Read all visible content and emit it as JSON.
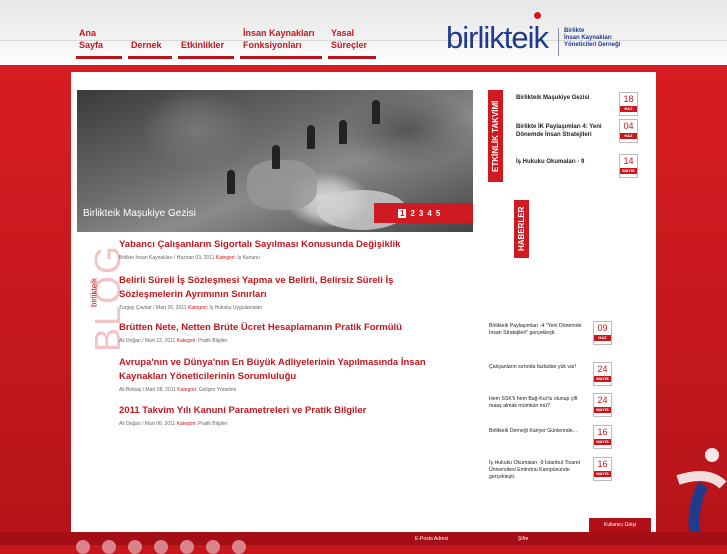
{
  "nav": {
    "items": [
      {
        "label": "Ana\nSayfa"
      },
      {
        "label": "\nDernek"
      },
      {
        "label": "\nEtkinlikler"
      },
      {
        "label": "İnsan Kaynakları\nFonksiyonları"
      },
      {
        "label": "Yasal\nSüreçler"
      }
    ]
  },
  "logo": {
    "word": "birlikteik",
    "subtitle": "Birlikte\nİnsan Kaynakları\nYöneticileri Derneği"
  },
  "hero": {
    "caption": "Birlikteik Maşukiye Gezisi",
    "pages": [
      "1",
      "2",
      "3",
      "4",
      "5"
    ]
  },
  "blog": {
    "label": "BLOG",
    "sublabel": "birlikteik",
    "posts": [
      {
        "title": "Yabancı Çalışanların Sigortalı Sayılması Konusunda Değişiklik",
        "meta": "Birlikte İnsan Kaynakları / Haziran 03, 2011",
        "cat_label": "Kategori:",
        "category": "İş Kanunu"
      },
      {
        "title": "Belirli Süreli İş Sözleşmesi Yapma ve Belirli, Belirsiz Süreli İş Sözleşmelerin Ayrımının Sınırları",
        "meta": "Turgay Çavdar / Mart 26, 2011",
        "cat_label": "Kategori:",
        "category": "İş Hukuku Uygulamaları"
      },
      {
        "title": "Brütten Nete, Netten Brüte Ücret Hesaplamanın Pratik Formülü",
        "meta": "Ali Doğan / Mart 23, 2011",
        "cat_label": "Kategori:",
        "category": "Pratik Bilgiler"
      },
      {
        "title": "Avrupa'nın ve Dünya'nın En Büyük Adliyelerinin Yapılmasında İnsan Kaynakları Yöneticilerinin Sorumluluğu",
        "meta": "Ali Bektaş / Mart 08, 2011",
        "cat_label": "Kategori:",
        "category": "Gelişim Yönetimi"
      },
      {
        "title": "2011 Takvim Yılı Kanuni Parametreleri ve Pratik Bilgiler",
        "meta": "Ali Doğan / Mart 06, 2011",
        "cat_label": "Kategori:",
        "category": "Pratik Bilgiler"
      }
    ]
  },
  "events": {
    "tab": "ETKİNLİK TAKVİMİ",
    "items": [
      {
        "text": "Birlikteik Maşukiye Gezisi",
        "day": "18",
        "month": "HAZ"
      },
      {
        "text": "Birlikte İK Paylaşımları 4: Yeni Dönemde İnsan Stratejileri",
        "day": "04",
        "month": "HAZ"
      },
      {
        "text": "İş Hukuku Okumaları - 9",
        "day": "14",
        "month": "MAYIS"
      }
    ]
  },
  "news": {
    "tab": "HABERLER",
    "items": [
      {
        "text": "Birlikteik Paylaşımları -4 \"Yeni Dönemde İnsan Stratejileri\" gerçekleşti.",
        "day": "09",
        "month": "HAZ"
      },
      {
        "text": "Çalışanların sırtında fazladan yük var!",
        "day": "24",
        "month": "MAYIS"
      },
      {
        "text": "Hem SSK'lı hem Bağ-Kur'lu olunup çift maaş almak mümkün mü?",
        "day": "24",
        "month": "MAYIS"
      },
      {
        "text": "Birlikteik Derneği Kariyer Günlerinde...",
        "day": "16",
        "month": "MAYIS"
      },
      {
        "text": "İş Hukuku Okumaları -9 İstanbul Ticaret Üniversitesi Eminönü Kampüsünde gerçekleşti.",
        "day": "16",
        "month": "MAYIS"
      }
    ]
  },
  "user_button": "Kullanıcı Girişi",
  "footer": {
    "email_label": "E-Posta Adresi",
    "password_label": "Şifre"
  },
  "colors": {
    "brand_red": "#c8161d",
    "brand_blue": "#203a8c"
  }
}
